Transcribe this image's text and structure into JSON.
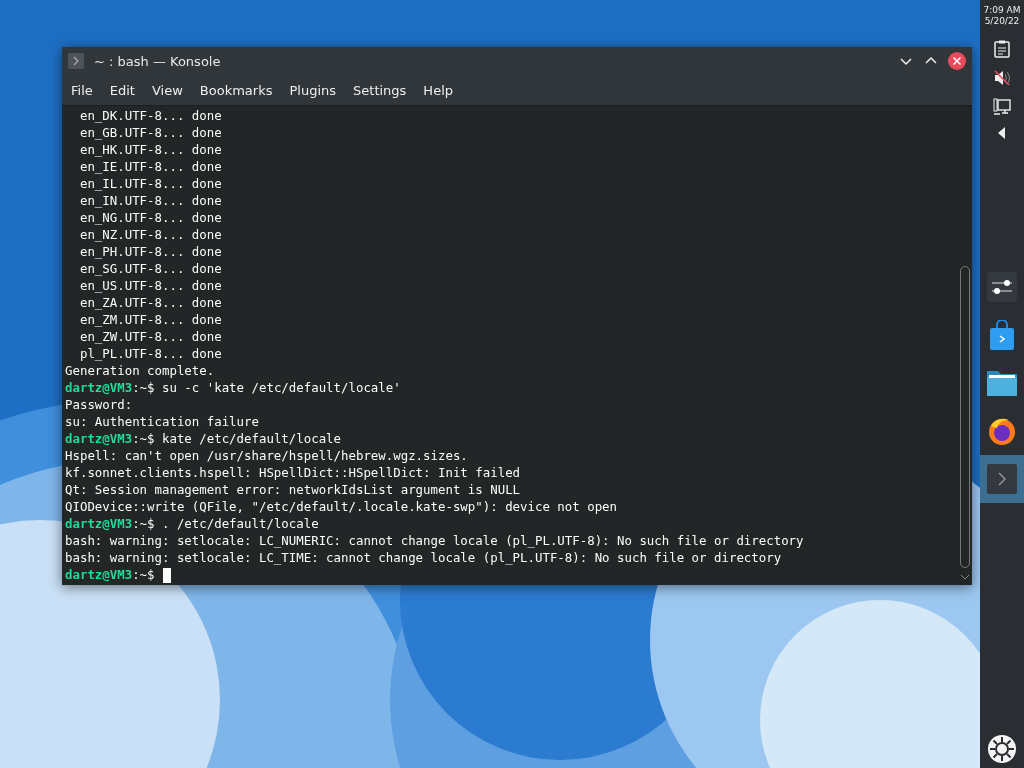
{
  "window": {
    "title": "~ : bash — Konsole"
  },
  "menu": [
    "File",
    "Edit",
    "View",
    "Bookmarks",
    "Plugins",
    "Settings",
    "Help"
  ],
  "terminal": {
    "lines": [
      {
        "kind": "output",
        "text": "  en_DK.UTF-8... done"
      },
      {
        "kind": "output",
        "text": "  en_GB.UTF-8... done"
      },
      {
        "kind": "output",
        "text": "  en_HK.UTF-8... done"
      },
      {
        "kind": "output",
        "text": "  en_IE.UTF-8... done"
      },
      {
        "kind": "output",
        "text": "  en_IL.UTF-8... done"
      },
      {
        "kind": "output",
        "text": "  en_IN.UTF-8... done"
      },
      {
        "kind": "output",
        "text": "  en_NG.UTF-8... done"
      },
      {
        "kind": "output",
        "text": "  en_NZ.UTF-8... done"
      },
      {
        "kind": "output",
        "text": "  en_PH.UTF-8... done"
      },
      {
        "kind": "output",
        "text": "  en_SG.UTF-8... done"
      },
      {
        "kind": "output",
        "text": "  en_US.UTF-8... done"
      },
      {
        "kind": "output",
        "text": "  en_ZA.UTF-8... done"
      },
      {
        "kind": "output",
        "text": "  en_ZM.UTF-8... done"
      },
      {
        "kind": "output",
        "text": "  en_ZW.UTF-8... done"
      },
      {
        "kind": "output",
        "text": "  pl_PL.UTF-8... done"
      },
      {
        "kind": "output",
        "text": "Generation complete."
      },
      {
        "kind": "prompt",
        "user": "dartz@VM3",
        "path": ":~$",
        "command": "su -c 'kate /etc/default/locale'"
      },
      {
        "kind": "output",
        "text": "Password:"
      },
      {
        "kind": "output",
        "text": "su: Authentication failure"
      },
      {
        "kind": "prompt",
        "user": "dartz@VM3",
        "path": ":~$",
        "command": "kate /etc/default/locale"
      },
      {
        "kind": "output",
        "text": "Hspell: can't open /usr/share/hspell/hebrew.wgz.sizes."
      },
      {
        "kind": "output",
        "text": "kf.sonnet.clients.hspell: HSpellDict::HSpellDict: Init failed"
      },
      {
        "kind": "output",
        "text": "Qt: Session management error: networkIdsList argument is NULL"
      },
      {
        "kind": "output",
        "text": "QIODevice::write (QFile, \"/etc/default/.locale.kate-swp\"): device not open"
      },
      {
        "kind": "prompt",
        "user": "dartz@VM3",
        "path": ":~$",
        "command": ". /etc/default/locale"
      },
      {
        "kind": "output",
        "text": "bash: warning: setlocale: LC_NUMERIC: cannot change locale (pl_PL.UTF-8): No such file or directory"
      },
      {
        "kind": "output",
        "text": "bash: warning: setlocale: LC_TIME: cannot change locale (pl_PL.UTF-8): No such file or directory"
      },
      {
        "kind": "prompt",
        "user": "dartz@VM3",
        "path": ":~$",
        "cursor": true
      }
    ]
  },
  "panel": {
    "time": "7:09 AM",
    "date": "5/20/22",
    "tray": [
      {
        "kind": "clipboard"
      },
      {
        "kind": "muted"
      },
      {
        "kind": "network"
      },
      {
        "kind": "expand"
      }
    ],
    "tasks": [
      {
        "kind": "settings",
        "selected": false
      },
      {
        "kind": "store",
        "selected": false
      },
      {
        "kind": "folder",
        "selected": false
      },
      {
        "kind": "browser",
        "selected": false
      },
      {
        "kind": "terminal",
        "selected": true
      }
    ]
  }
}
